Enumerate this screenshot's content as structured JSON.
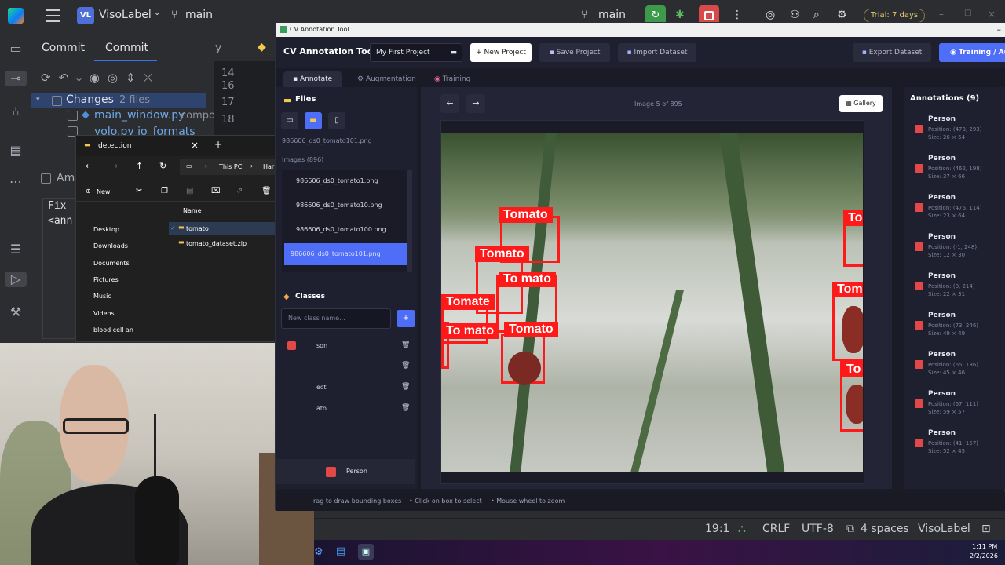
{
  "ide": {
    "project_badge": "VL",
    "project_name": "VisoLabel",
    "branch": "main",
    "branch_right": "main",
    "trial": "Trial: 7 days",
    "commit_tab_1": "Commit",
    "commit_tab_2": "Commit",
    "changes_label": "Changes",
    "changes_count": "2 files",
    "changed_files": [
      "main_window.py",
      "yolo.py  io_formats"
    ],
    "changed_file_suffix": "compo",
    "amend_label": "Ame",
    "commit_msg_1": "Fix",
    "commit_msg_2": "<ann",
    "line_numbers": [
      "14",
      "16",
      "17",
      "18"
    ],
    "editor_tab_fragment": "y",
    "status": {
      "position": "19:1",
      "line_sep": "CRLF",
      "encoding": "UTF-8",
      "indent": "4 spaces",
      "project": "VisoLabel"
    }
  },
  "explorer": {
    "title": "detection",
    "breadcrumb_1": "This PC",
    "breadcrumb_2": "Har",
    "new_label": "New",
    "column_name": "Name",
    "quick_access": [
      "Desktop",
      "Downloads",
      "Documents",
      "Pictures",
      "Music",
      "Videos",
      "blood cell an"
    ],
    "files": [
      "tomato",
      "tomato_dataset.zip"
    ]
  },
  "cv": {
    "window_title": "CV Annotation Tool",
    "app_title": "CV Annotation Tool",
    "project_select": "My First Project",
    "buttons": {
      "new_project": "+ New Project",
      "save_project": "Save Project",
      "import_dataset": "Import Dataset",
      "export_dataset": "Export Dataset",
      "training": "Training / Au"
    },
    "tabs": [
      "Annotate",
      "Augmentation",
      "Training"
    ],
    "files_heading": "Files",
    "current_file": "986606_ds0_tomato101.png",
    "images_count": "Images (896)",
    "image_list": [
      "986606_ds0_tomato1.png",
      "986606_ds0_tomato10.png",
      "986606_ds0_tomato100.png",
      "986606_ds0_tomato101.png"
    ],
    "classes_heading": "Classes",
    "class_placeholder": "New class name...",
    "add_class": "+",
    "class_fragments": [
      "son",
      "",
      "ect",
      "ato"
    ],
    "selected_class": "Person",
    "nav_prev": "←",
    "nav_next": "→",
    "image_counter": "Image 5 of 895",
    "gallery": "Gallery",
    "annotations_heading": "Annotations (9)",
    "annotations": [
      {
        "label": "Person",
        "pos": "Position: (473, 293)",
        "size": "Size: 26 × 54"
      },
      {
        "label": "Person",
        "pos": "Position: (462, 198)",
        "size": "Size: 37 × 66"
      },
      {
        "label": "Person",
        "pos": "Position: (476, 114)",
        "size": "Size: 23 × 64"
      },
      {
        "label": "Person",
        "pos": "Position: (-1, 248)",
        "size": "Size: 12 × 30"
      },
      {
        "label": "Person",
        "pos": "Position: (0, 214)",
        "size": "Size: 22 × 31"
      },
      {
        "label": "Person",
        "pos": "Position: (73, 246)",
        "size": "Size: 49 × 49"
      },
      {
        "label": "Person",
        "pos": "Position: (65, 186)",
        "size": "Size: 45 × 46"
      },
      {
        "label": "Person",
        "pos": "Position: (67, 111)",
        "size": "Size: 59 × 57"
      },
      {
        "label": "Person",
        "pos": "Position: (41, 157)",
        "size": "Size: 52 × 45"
      }
    ],
    "box_labels": [
      "Tomato",
      "Tomato",
      "To mato",
      "Tomate",
      "To mato",
      "Tomato",
      "To",
      "Tom",
      "To"
    ],
    "status_hints": [
      "rag to draw bounding boxes",
      "• Click on box to select",
      "• Mouse wheel to zoom"
    ]
  },
  "taskbar": {
    "time": "1:11 PM",
    "date": "2/2/2026"
  },
  "colors": {
    "accent": "#4f6ef7",
    "box": "#ff1a1a",
    "class_swatch": "#e34848"
  }
}
